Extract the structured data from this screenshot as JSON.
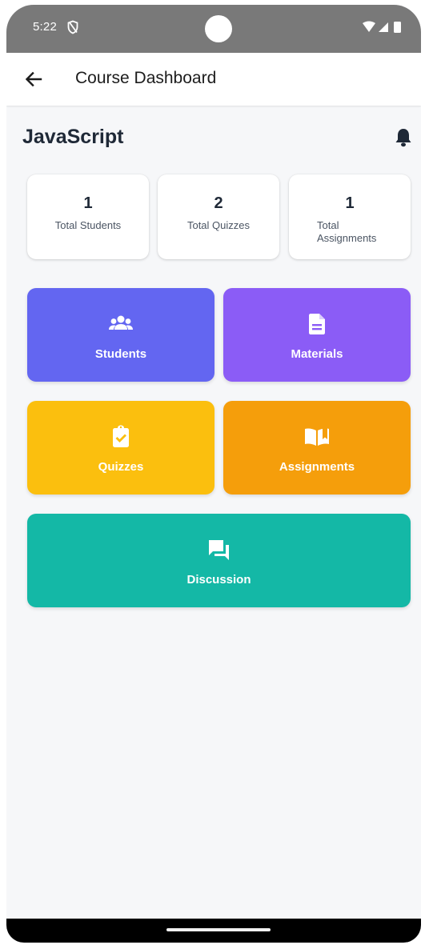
{
  "status_bar": {
    "time": "5:22",
    "icons": [
      "vpn-shield-icon",
      "wifi-icon",
      "signal-icon",
      "battery-icon"
    ]
  },
  "app_bar": {
    "title": "Course Dashboard",
    "back_icon": "arrow-back-icon"
  },
  "course": {
    "title": "JavaScript",
    "notification_icon": "bell-icon"
  },
  "stats": [
    {
      "value": "1",
      "label": "Total Students"
    },
    {
      "value": "2",
      "label": "Total Quizzes"
    },
    {
      "value": "1",
      "label": "Total\nAssignments"
    }
  ],
  "tiles": [
    {
      "label": "Students",
      "icon": "people-icon",
      "color": "#6366f1"
    },
    {
      "label": "Materials",
      "icon": "document-icon",
      "color": "#8b5cf6"
    },
    {
      "label": "Quizzes",
      "icon": "clipboard-check-icon",
      "color": "#fbbf0e"
    },
    {
      "label": "Assignments",
      "icon": "open-book-icon",
      "color": "#f59e0b"
    },
    {
      "label": "Discussion",
      "icon": "chat-bubbles-icon",
      "color": "#14b8a6"
    }
  ]
}
